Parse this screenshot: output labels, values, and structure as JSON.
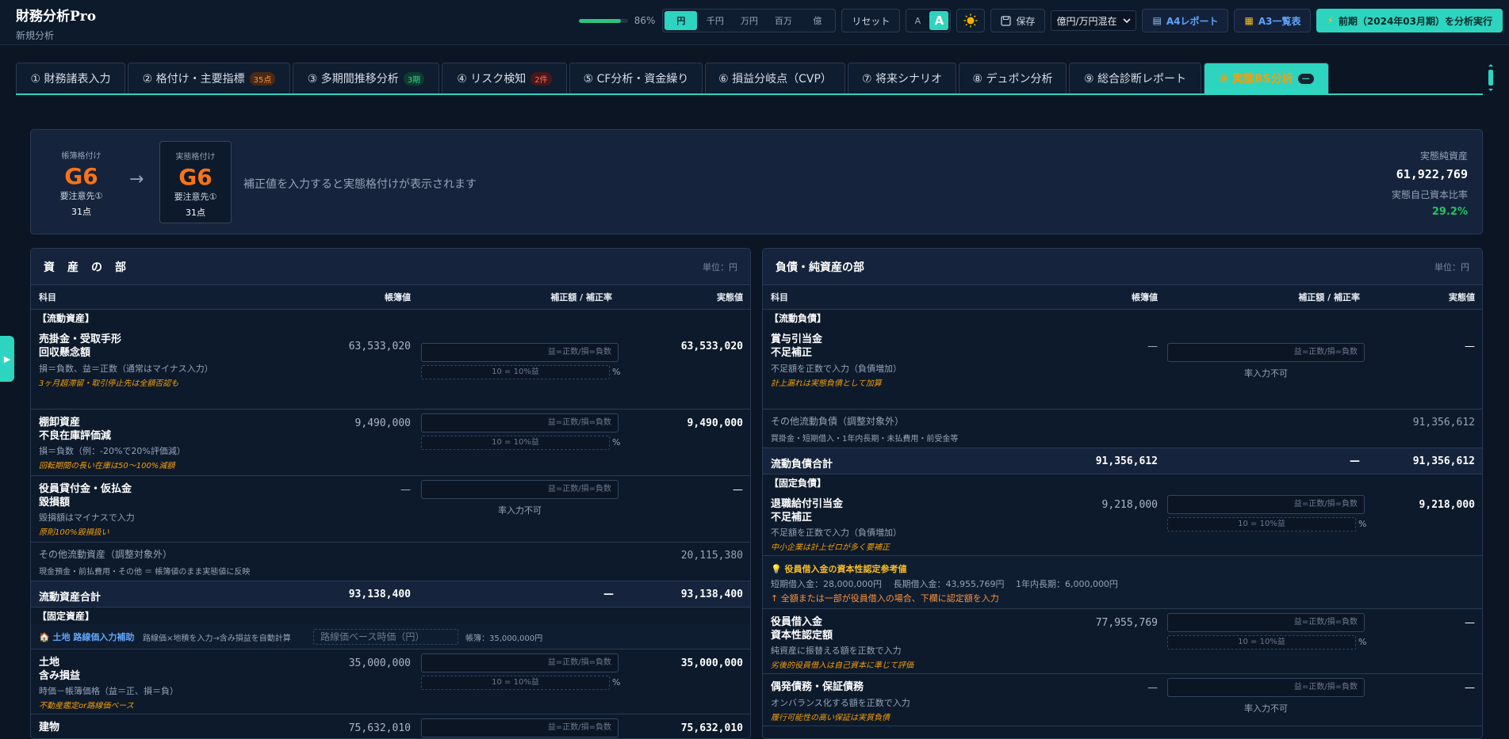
{
  "app": {
    "title": "財務分析Pro",
    "subtitle": "新規分析"
  },
  "toolbar": {
    "progress_pct": "86%",
    "progress_value": 0.86,
    "units": [
      "円",
      "千円",
      "万円",
      "百万",
      "億"
    ],
    "unit_selected": "円",
    "reset_label": "リセット",
    "font_small": "A",
    "font_large": "A",
    "save_label": "保存",
    "display_mode": "億円/万円混在",
    "a4_report": "A4レポート",
    "a3_list": "A3一覧表",
    "run_label": "前期（2024年03月期）を分析実行"
  },
  "tabs": [
    {
      "label": "① 財務諸表入力",
      "badge": ""
    },
    {
      "label": "② 格付け・主要指標",
      "badge": "35点"
    },
    {
      "label": "③ 多期間推移分析",
      "badge": "3期"
    },
    {
      "label": "④ リスク検知",
      "badge": "2件"
    },
    {
      "label": "⑤ CF分析・資金繰り",
      "badge": ""
    },
    {
      "label": "⑥ 損益分岐点（CVP）",
      "badge": ""
    },
    {
      "label": "⑦ 将来シナリオ",
      "badge": ""
    },
    {
      "label": "⑧ デュポン分析",
      "badge": ""
    },
    {
      "label": "⑨ 総合診断レポート",
      "badge": ""
    },
    {
      "label": "⑩ 実態BS分析",
      "badge": "—"
    }
  ],
  "summary": {
    "book": {
      "label": "帳簿格付け",
      "grade": "G6",
      "class": "要注意先①",
      "points": "31点"
    },
    "actual": {
      "label": "実態格付け",
      "grade": "G6",
      "class": "要注意先①",
      "points": "31点"
    },
    "arrow": "→",
    "message": "補正値を入力すると実態格付けが表示されます",
    "net_assets_label": "実態純資産",
    "net_assets": "61,922,769",
    "equity_ratio_label": "実態自己資本比率",
    "equity_ratio": "29.2%"
  },
  "common": {
    "col_item": "科目",
    "col_book": "帳簿値",
    "col_adj": "補正額 / 補正率",
    "col_actual": "実態値",
    "unit": "単位：円",
    "adj_placeholder": "益=正数/損=負数",
    "rate_placeholder": "10 = 10%益",
    "pct": "%",
    "na": "率入力不可",
    "dash": "—"
  },
  "assets": {
    "title": "資　産　の　部",
    "current_section": "【流動資産】",
    "rows": [
      {
        "name1": "売掛金・受取手形",
        "name2": "回収懸念額",
        "book": "63,533,020",
        "actual": "63,533,020",
        "note": "損＝負数、益＝正数（通常はマイナス入力）",
        "warn": "3ヶ月超滞留・取引停止先は全額否認も"
      },
      {
        "name1": "棚卸資産",
        "name2": "不良在庫評価減",
        "book": "9,490,000",
        "actual": "9,490,000",
        "note": "損＝負数（例：-20%で20%評価減）",
        "warn": "回転期間の長い在庫は50〜100%減額"
      },
      {
        "name1": "役員貸付金・仮払金",
        "name2": "毀損額",
        "book": "—",
        "actual": "—",
        "note": "毀損額はマイナスで入力",
        "warn": "原則100%毀損扱い"
      }
    ],
    "other": {
      "name": "その他流動資産（調整対象外）",
      "note": "現金預金・前払費用・その他 ＝ 帳簿値のまま実態値に反映",
      "actual": "20,115,380"
    },
    "current_total": {
      "label": "流動資産合計",
      "book": "93,138,400",
      "adj": "—",
      "actual": "93,138,400"
    },
    "fixed_section": "【固定資産】",
    "land_helper": {
      "label": "土地 路線価入力補助",
      "desc": "路線価×地積を入力→含み損益を自動計算",
      "placeholder": "路線価ベース時価（円）",
      "book_note": "帳簿：35,000,000円"
    },
    "land": {
      "name1": "土地",
      "name2": "含み損益",
      "book": "35,000,000",
      "actual": "35,000,000",
      "note": "時価－帳簿価格（益＝正、損＝負）",
      "warn": "不動産鑑定or路線価ベース"
    },
    "building": {
      "name1": "建物",
      "book": "75,632,010",
      "actual": "75,632,010"
    }
  },
  "liabilities": {
    "title": "負債・純資産の部",
    "current_section": "【流動負債】",
    "bonus": {
      "name1": "賞与引当金",
      "name2": "不足補正",
      "book": "—",
      "actual": "—",
      "note": "不足額を正数で入力（負債増加）",
      "warn": "計上漏れは実態負債として加算"
    },
    "other": {
      "name": "その他流動負債（調整対象外）",
      "note": "買掛金・短期借入・1年内長期・未払費用・前受金等",
      "actual": "91,356,612"
    },
    "current_total": {
      "label": "流動負債合計",
      "book": "91,356,612",
      "adj": "—",
      "actual": "91,356,612"
    },
    "fixed_section": "【固定負債】",
    "retire": {
      "name1": "退職給付引当金",
      "name2": "不足補正",
      "book": "9,218,000",
      "actual": "9,218,000",
      "note": "不足額を正数で入力（負債増加）",
      "warn": "中小企業は計上ゼロが多く要補正"
    },
    "info": {
      "title": "役員借入金の資本性認定参考値",
      "details": "短期借入金：28,000,000円　 長期借入金：43,955,769円　 1年内長期：6,000,000円",
      "hint": "↑ 全額または一部が役員借入の場合、下欄に認定額を入力"
    },
    "officer": {
      "name1": "役員借入金",
      "name2": "資本性認定額",
      "book": "77,955,769",
      "actual": "—",
      "note": "純資産に振替える額を正数で入力",
      "warn": "劣後的役員借入は自己資本に準じて評価"
    },
    "contingent": {
      "name1": "偶発債務・保証債務",
      "book": "—",
      "actual": "—",
      "note": "オンバランス化する額を正数で入力",
      "warn": "履行可能性の高い保証は実質負債"
    }
  }
}
